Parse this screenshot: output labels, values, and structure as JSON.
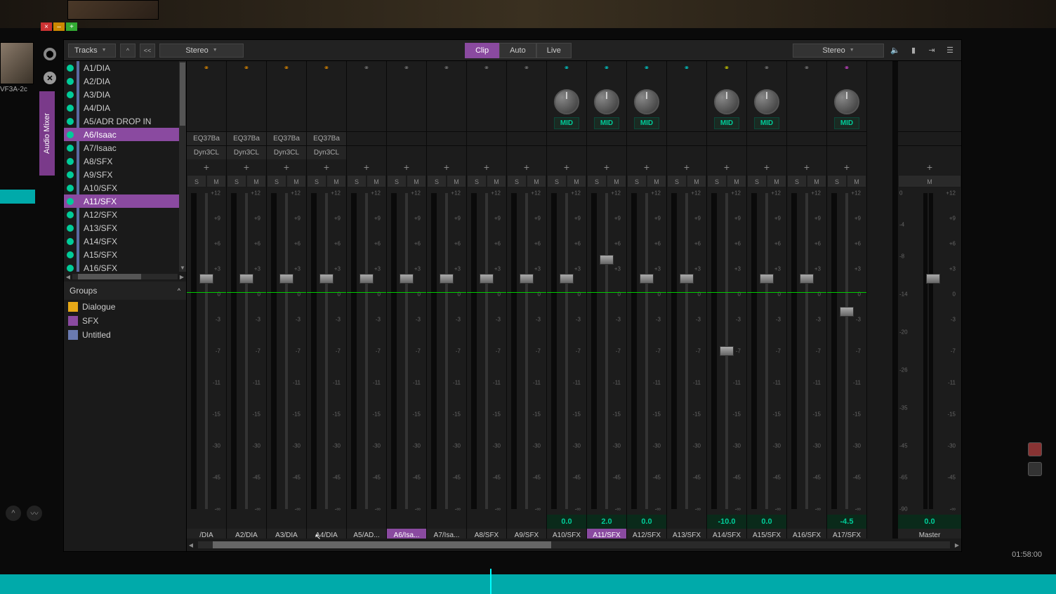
{
  "thumb_label": "VF3A-2c",
  "vtab": "Audio Mixer",
  "toolbar": {
    "tracks": "Tracks",
    "format_left": "Stereo",
    "modes": [
      "Clip",
      "Auto",
      "Live"
    ],
    "active_mode": 0,
    "format_right": "Stereo"
  },
  "tracks": [
    {
      "name": "A1/DIA",
      "bar": "blue",
      "sel": false
    },
    {
      "name": "A2/DIA",
      "bar": "blue",
      "sel": false
    },
    {
      "name": "A3/DIA",
      "bar": "blue",
      "sel": false
    },
    {
      "name": "A4/DIA",
      "bar": "blue",
      "sel": false
    },
    {
      "name": "A5/ADR DROP IN",
      "bar": "blue",
      "sel": false
    },
    {
      "name": "A6/Isaac",
      "bar": "purple",
      "sel": true
    },
    {
      "name": "A7/Isaac",
      "bar": "blue",
      "sel": false
    },
    {
      "name": "A8/SFX",
      "bar": "blue",
      "sel": false
    },
    {
      "name": "A9/SFX",
      "bar": "blue",
      "sel": false
    },
    {
      "name": "A10/SFX",
      "bar": "blue",
      "sel": false
    },
    {
      "name": "A11/SFX",
      "bar": "purple",
      "sel": true
    },
    {
      "name": "A12/SFX",
      "bar": "blue",
      "sel": false
    },
    {
      "name": "A13/SFX",
      "bar": "blue",
      "sel": false
    },
    {
      "name": "A14/SFX",
      "bar": "blue",
      "sel": false
    },
    {
      "name": "A15/SFX",
      "bar": "blue",
      "sel": false
    },
    {
      "name": "A16/SFX",
      "bar": "blue",
      "sel": false
    }
  ],
  "groups_label": "Groups",
  "groups": [
    {
      "name": "Dialogue",
      "color": "#e6a817"
    },
    {
      "name": "SFX",
      "color": "#8a4aa0"
    },
    {
      "name": "Untitled",
      "color": "#6a7ab0"
    }
  ],
  "scale": [
    "+12",
    "+9",
    "+6",
    "+3",
    "0",
    "-3",
    "-7",
    "-11",
    "-15",
    "-30",
    "-45",
    "-∞"
  ],
  "master_scale_l": [
    "0",
    "-4",
    "-8",
    "-14",
    "-20",
    "-26",
    "-35",
    "-45",
    "-65",
    "-90"
  ],
  "mid": "MID",
  "solo": "S",
  "mute": "M",
  "eq": "EQ37Ba",
  "dyn": "Dyn3CL",
  "strips": [
    {
      "name": "/DIA",
      "link": "orange",
      "eq": true,
      "dyn": true,
      "gain": "",
      "knob": false,
      "fader": 28
    },
    {
      "name": "A2/DIA",
      "link": "orange",
      "eq": true,
      "dyn": true,
      "gain": "",
      "knob": false,
      "fader": 28
    },
    {
      "name": "A3/DIA",
      "link": "orange",
      "eq": true,
      "dyn": true,
      "gain": "",
      "knob": false,
      "fader": 28
    },
    {
      "name": "A4/DIA",
      "link": "orange",
      "eq": true,
      "dyn": true,
      "gain": "",
      "knob": false,
      "fader": 28
    },
    {
      "name": "A5/AD...",
      "link": "grey",
      "eq": false,
      "dyn": false,
      "gain": "",
      "knob": false,
      "fader": 28
    },
    {
      "name": "A6/Isa...",
      "link": "grey",
      "eq": false,
      "dyn": false,
      "gain": "",
      "knob": false,
      "fader": 28,
      "hl": true
    },
    {
      "name": "A7/Isa...",
      "link": "grey",
      "eq": false,
      "dyn": false,
      "gain": "",
      "knob": false,
      "fader": 28
    },
    {
      "name": "A8/SFX",
      "link": "grey",
      "eq": false,
      "dyn": false,
      "gain": "",
      "knob": false,
      "fader": 28
    },
    {
      "name": "A9/SFX",
      "link": "grey",
      "eq": false,
      "dyn": false,
      "gain": "",
      "knob": false,
      "fader": 28
    },
    {
      "name": "A10/SFX",
      "link": "cyan",
      "eq": false,
      "dyn": false,
      "gain": "0.0",
      "knob": true,
      "fader": 28
    },
    {
      "name": "A11/SFX",
      "link": "cyan",
      "eq": false,
      "dyn": false,
      "gain": "2.0",
      "knob": true,
      "fader": 22,
      "hl": true
    },
    {
      "name": "A12/SFX",
      "link": "cyan",
      "eq": false,
      "dyn": false,
      "gain": "0.0",
      "knob": true,
      "fader": 28
    },
    {
      "name": "A13/SFX",
      "link": "cyan",
      "eq": false,
      "dyn": false,
      "gain": "",
      "knob": false,
      "fader": 28
    },
    {
      "name": "A14/SFX",
      "link": "yellow",
      "eq": false,
      "dyn": false,
      "gain": "-10.0",
      "knob": true,
      "fader": 50
    },
    {
      "name": "A15/SFX",
      "link": "grey",
      "eq": false,
      "dyn": false,
      "gain": "0.0",
      "knob": true,
      "fader": 28
    },
    {
      "name": "A16/SFX",
      "link": "grey",
      "eq": false,
      "dyn": false,
      "gain": "",
      "knob": false,
      "fader": 28
    },
    {
      "name": "A17/SFX",
      "link": "mag",
      "eq": false,
      "dyn": false,
      "gain": "-4.5",
      "knob": true,
      "fader": 38
    }
  ],
  "master": {
    "name": "Master",
    "gain": "0.0"
  },
  "timecode": "01:58:00"
}
